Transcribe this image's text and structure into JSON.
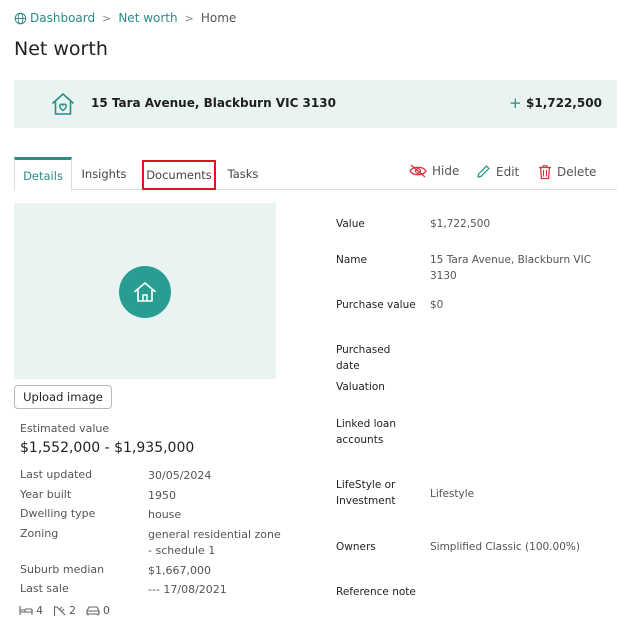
{
  "breadcrumb": {
    "items": [
      "Dashboard",
      "Net worth",
      "Home"
    ],
    "separator": ">"
  },
  "page": {
    "title": "Net worth"
  },
  "banner": {
    "address": "15 Tara Avenue, Blackburn VIC 3130",
    "plus": "+",
    "total": "$1,722,500",
    "icon": "house-heart-icon"
  },
  "tabs": {
    "details": "Details",
    "insights": "Insights",
    "documents": "Documents",
    "tasks": "Tasks",
    "active": "Details"
  },
  "actions": {
    "hide": "Hide",
    "edit": "Edit",
    "delete": "Delete"
  },
  "property": {
    "upload_label": "Upload image",
    "estimated_label": "Estimated value",
    "estimated_range": "$1,552,000 - $1,935,000",
    "facts": [
      {
        "key": "Last updated",
        "value": "30/05/2024"
      },
      {
        "key": "Year built",
        "value": "1950"
      },
      {
        "key": "Dwelling type",
        "value": "house"
      },
      {
        "key": "Zoning",
        "value": "general residential zone - schedule 1"
      },
      {
        "key": "Suburb median",
        "value": "$1,667,000"
      },
      {
        "key": "Last sale",
        "value": "--- 17/08/2021"
      }
    ],
    "features": {
      "bedrooms": "4",
      "bathrooms": "2",
      "car_spaces": "0"
    }
  },
  "details": [
    {
      "key": "Value",
      "value": "$1,722,500"
    },
    {
      "key": "Name",
      "value": "15 Tara Avenue, Blackburn VIC 3130"
    },
    {
      "key": "Purchase value",
      "value": "$0"
    },
    {
      "key": "Purchased date",
      "value": ""
    },
    {
      "key": "Valuation",
      "value": ""
    },
    {
      "key": "Linked loan accounts",
      "value": ""
    },
    {
      "key": "LifeStyle or Investment",
      "value": "Lifestyle"
    },
    {
      "key": "Owners",
      "value": "Simplified Classic (100.00%)"
    },
    {
      "key": "Reference note",
      "value": ""
    }
  ],
  "colors": {
    "accent": "#2a8c84",
    "banner_bg": "#e8f3f2",
    "delete": "#d6343f",
    "highlight": "#e0141e"
  }
}
